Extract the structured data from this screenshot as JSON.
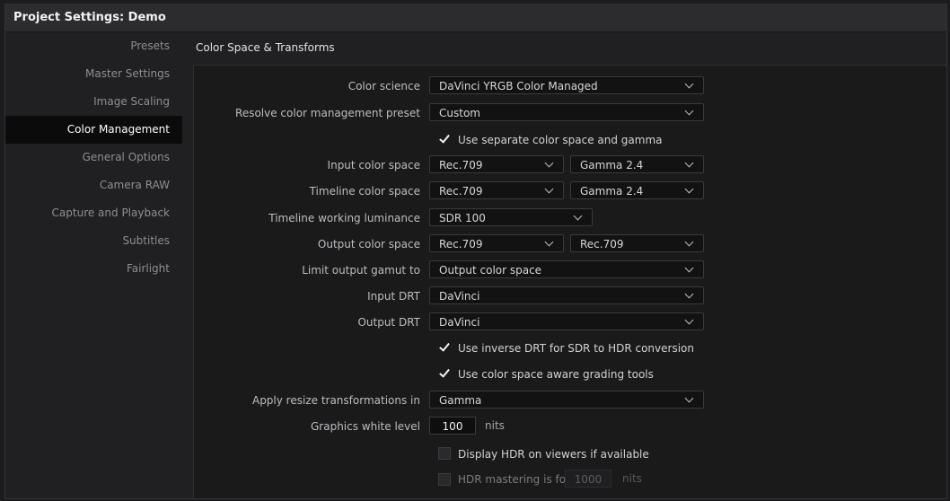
{
  "window": {
    "title": "Project Settings:  Demo"
  },
  "sidebar": {
    "items": [
      {
        "label": "Presets"
      },
      {
        "label": "Master Settings"
      },
      {
        "label": "Image Scaling"
      },
      {
        "label": "Color Management"
      },
      {
        "label": "General Options"
      },
      {
        "label": "Camera RAW"
      },
      {
        "label": "Capture and Playback"
      },
      {
        "label": "Subtitles"
      },
      {
        "label": "Fairlight"
      }
    ],
    "active_index": 3
  },
  "section": {
    "title": "Color Space & Transforms"
  },
  "form": {
    "color_science": {
      "label": "Color science",
      "value": "DaVinci YRGB Color Managed"
    },
    "preset": {
      "label": "Resolve color management preset",
      "value": "Custom"
    },
    "separate_gamma": {
      "label": "Use separate color space and gamma",
      "checked": true
    },
    "input_color_space": {
      "label": "Input color space",
      "space": "Rec.709",
      "gamma": "Gamma 2.4"
    },
    "timeline_color_space": {
      "label": "Timeline color space",
      "space": "Rec.709",
      "gamma": "Gamma 2.4"
    },
    "timeline_luminance": {
      "label": "Timeline working luminance",
      "value": "SDR 100"
    },
    "output_color_space": {
      "label": "Output color space",
      "space": "Rec.709",
      "gamma": "Rec.709"
    },
    "limit_gamut": {
      "label": "Limit output gamut to",
      "value": "Output color space"
    },
    "input_drt": {
      "label": "Input DRT",
      "value": "DaVinci"
    },
    "output_drt": {
      "label": "Output DRT",
      "value": "DaVinci"
    },
    "inverse_drt": {
      "label": "Use inverse DRT for SDR to HDR conversion",
      "checked": true
    },
    "aware_grading": {
      "label": "Use color space aware grading tools",
      "checked": true
    },
    "resize_transform": {
      "label": "Apply resize transformations in",
      "value": "Gamma"
    },
    "graphics_white": {
      "label": "Graphics white level",
      "value": "100",
      "unit": "nits"
    },
    "display_hdr": {
      "label": "Display HDR on viewers if available",
      "checked": false
    },
    "hdr_mastering": {
      "label": "HDR mastering is for",
      "value": "1000",
      "unit": "nits",
      "checked": false
    }
  }
}
